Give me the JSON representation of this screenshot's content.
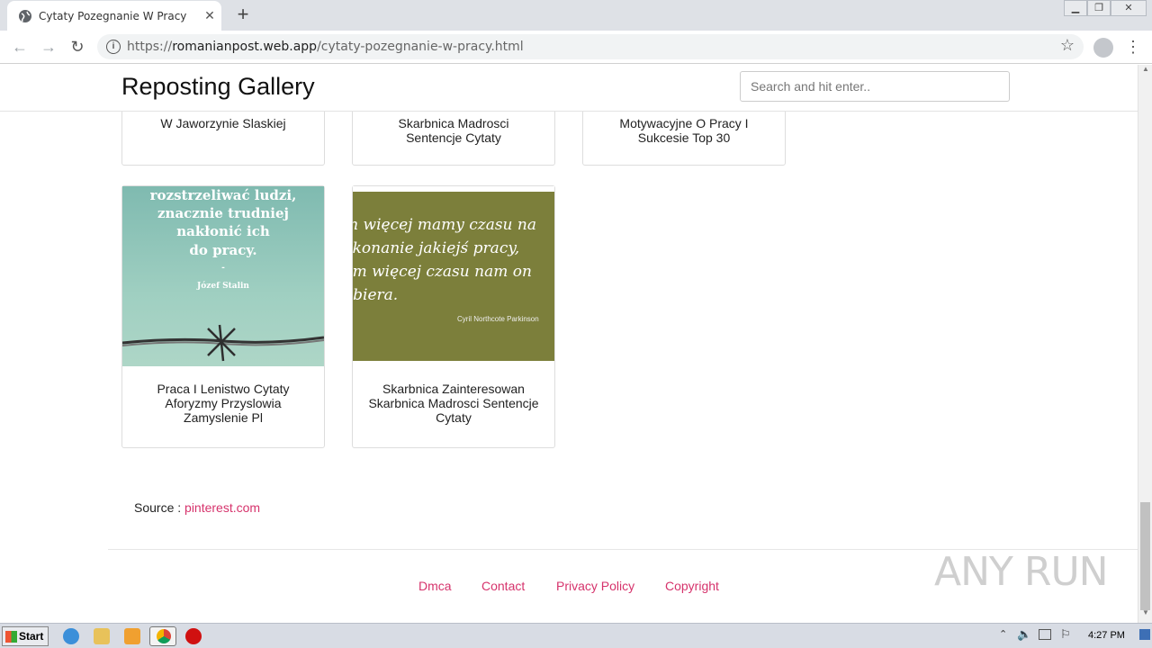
{
  "browser": {
    "tab_title": "Cytaty Pozegnanie W Pracy",
    "url_scheme": "https://",
    "url_host": "romanianpost.web.app",
    "url_path": "/cytaty-pozegnanie-w-pracy.html"
  },
  "site": {
    "brand": "Reposting Gallery",
    "search_placeholder": "Search and hit enter.."
  },
  "cards_top": [
    {
      "caption": "W Jaworzynie Slaskiej"
    },
    {
      "caption": "Skarbnica Madrosci\nSentencje Cytaty"
    },
    {
      "caption": "Motywacyjne O Pracy I\nSukcesie Top 30"
    }
  ],
  "cards": [
    {
      "caption": "Praca I Lenistwo Cytaty Aforyzmy Przyslowia Zamyslenie Pl",
      "quote_lines": [
        "rozstrzeliwać ludzi,",
        "znacznie trudniej",
        "nakłonić ich",
        "do pracy."
      ],
      "quote_dash": "-",
      "author": "Józef Stalin"
    },
    {
      "caption": "Skarbnica Zainteresowan Skarbnica Madrosci Sentencje Cytaty",
      "quote_lines": [
        "m więcej mamy czasu na",
        "ykonanie jakiejś pracy,",
        "ym więcej czasu nam on",
        "abiera."
      ],
      "author": "Cyril Northcote Parkinson"
    }
  ],
  "source": {
    "label": "Source : ",
    "link": "pinterest.com"
  },
  "footer": [
    "Dmca",
    "Contact",
    "Privacy Policy",
    "Copyright"
  ],
  "watermark": "ANY RUN",
  "taskbar": {
    "start": "Start",
    "clock": "4:27 PM"
  }
}
